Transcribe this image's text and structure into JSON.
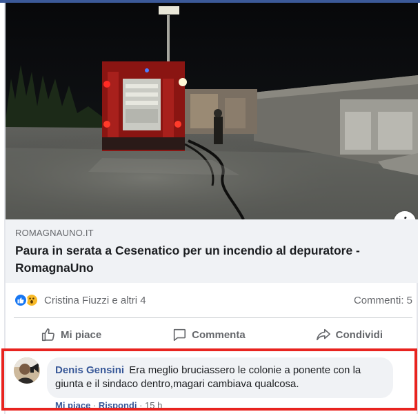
{
  "photo": {
    "alt": "",
    "info_label": "i"
  },
  "link_preview": {
    "domain": "ROMAGNAUNO.IT",
    "headline": "Paura in serata a Cesenatico per un incendio al depuratore - RomagnaUno"
  },
  "reactions": {
    "icons": [
      "like-icon",
      "wow-icon"
    ],
    "names": "Cristina Fiuzzi e altri 4",
    "comments_count": "Commenti: 5"
  },
  "actions": {
    "like_label": "Mi piace",
    "comment_label": "Commenta",
    "share_label": "Condividi"
  },
  "comment": {
    "author": "Denis Gensini",
    "text": "Era meglio bruciassero le colonie a ponente con la giunta e il sindaco dentro,magari cambiava qualcosa.",
    "like_link": "Mi piace",
    "separator": " · ",
    "reply_link": "Rispondi",
    "time": "15 h"
  },
  "colors": {
    "facebook_blue": "#1877f2",
    "link_blue": "#385898",
    "highlight_red": "#e8231f",
    "muted_gray": "#65676b"
  }
}
